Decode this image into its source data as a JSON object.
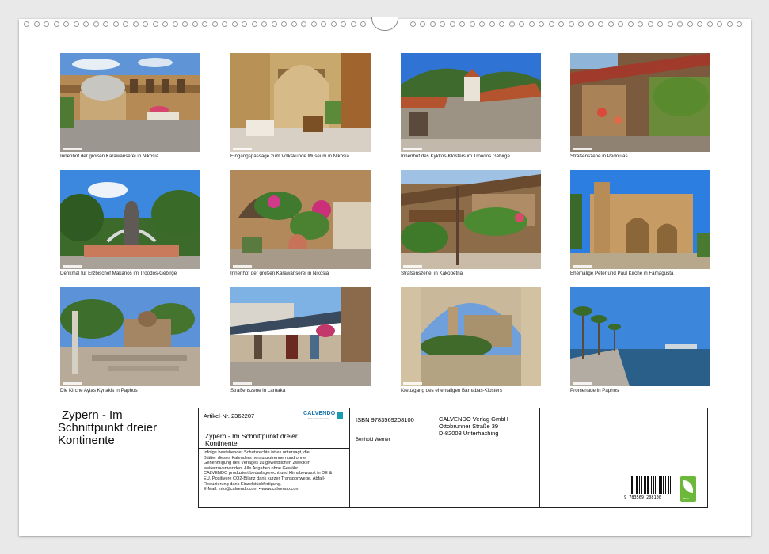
{
  "photos": [
    {
      "caption": "Innenhof der großen Karawanserei in Nikosia"
    },
    {
      "caption": "Eingangspassage zum Volkskunde Museum in Nikosia"
    },
    {
      "caption": "Innenhof des Kykkos-Klosters im Troodos Gebirge"
    },
    {
      "caption": "Straßenszene in Pedoulas"
    },
    {
      "caption": "Denkmal für Erzbischof Makarios im Troodos-Gebirge"
    },
    {
      "caption": "Innenhof der großen Karawanserei in Nikosia"
    },
    {
      "caption": "Straßenszene. in Kakopetria"
    },
    {
      "caption": "Ehemalige Peter und Paul Kirche in Famagusta"
    },
    {
      "caption": "Die Kirche Ayias Kyriakis in Paphos"
    },
    {
      "caption": "Straßenszene in Larnaka"
    },
    {
      "caption": "Kreuzgang des ehemaligen Barnabas-Klosters"
    },
    {
      "caption": "Promenade in Paphos"
    }
  ],
  "calendar": {
    "title_line1": "Zypern - Im",
    "title_line2": "Schnittpunkt dreier",
    "title_line3": "Kontinente",
    "article_no": "Artikel-Nr. 2362207",
    "logo_text": "CALVENDO",
    "logo_sub": "Dein Kalenderverlag",
    "subtitle_line1": "Zypern - Im Schnittpunkt dreier",
    "subtitle_line2": "Kontinente",
    "legal_lines": [
      "Infolge bestehender Schutzrechte ist es untersagt, die",
      "Blätter dieses Kalenders herauszutrennen und ohne",
      "Genehmigung des Verlages zu gewerblichen Zwecken",
      "weiterzuverwenden. Alle Angaben ohne Gewähr.",
      "CALVENDO produziert bedarfsgerecht und klimabewusst in DE &",
      "EU. Positivere CO2-Bilanz dank kurzer Transportwege. Abfall-",
      "Reduzierung dank Einzelstückfertigung.",
      "E-Mail: info@calvendo.com • www.calvendo.com"
    ],
    "isbn": "ISBN 9783569208100",
    "author": "Berthold Werner",
    "publisher_line1": "CALVENDO Verlag GmbH",
    "publisher_line2": "Ottobrunner Straße 39",
    "publisher_line3": "D-82008 Unterhaching",
    "barcode_number": "9 783569 208100",
    "eco_label": "feco"
  }
}
